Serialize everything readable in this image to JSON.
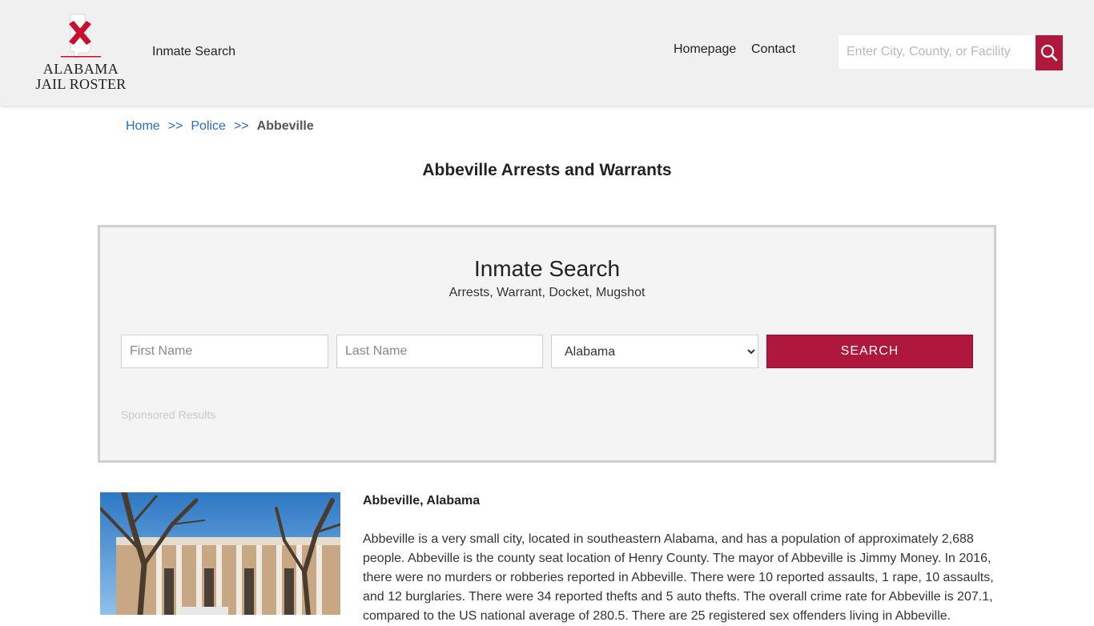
{
  "header": {
    "logo_line1": "ALABAMA",
    "logo_line2": "JAIL ROSTER",
    "nav_inmate_search": "Inmate Search",
    "nav_homepage": "Homepage",
    "nav_contact": "Contact",
    "search_placeholder": "Enter City, County, or Facility",
    "search_icon": "search-icon",
    "accent_color": "#b0173c"
  },
  "breadcrumb": {
    "home": "Home",
    "separator": ">>",
    "police": "Police",
    "current": "Abbeville"
  },
  "page_title": "Abbeville Arrests and Warrants",
  "inmate_search": {
    "title": "Inmate Search",
    "subtitle": "Arrests, Warrant, Docket, Mugshot",
    "first_name_placeholder": "First Name",
    "last_name_placeholder": "Last Name",
    "state_selected": "Alabama",
    "search_button": "SEARCH",
    "sponsored": "Sponsored Results"
  },
  "article": {
    "heading": "Abbeville, Alabama",
    "body": "Abbeville is a very small city, located in southeastern Alabama, and has a population of approximately 2,688 people. Abbeville is the county seat location of Henry County. The mayor of Abbeville is Jimmy Money. In 2016, there were no murders or robberies reported in Abbeville. There were 10 reported assaults, 1 rape, 10 assaults, and 12 burglaries. There were 34 reported thefts and 5 auto thefts. The overall crime rate for Abbeville is 207.1, compared to the US national average of 280.5. There are 25 registered sex offenders living in Abbeville."
  }
}
